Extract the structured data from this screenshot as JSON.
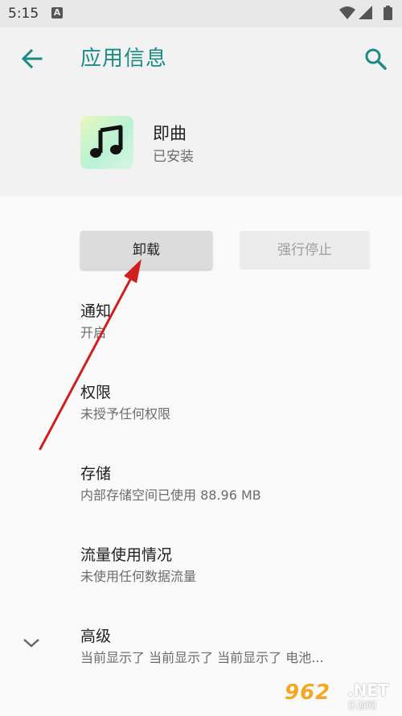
{
  "status_bar": {
    "time": "5:15",
    "notification_icon_letter": "A",
    "icons": [
      "wifi-icon",
      "signal-icon",
      "battery-icon"
    ]
  },
  "header": {
    "title": "应用信息",
    "back_icon": "arrow-left-icon",
    "search_icon": "search-icon"
  },
  "app": {
    "name": "即曲",
    "status": "已安装",
    "icon": "music-note-icon"
  },
  "buttons": {
    "uninstall": "卸载",
    "force_stop": "强行停止"
  },
  "items": [
    {
      "title": "通知",
      "summary": "开启"
    },
    {
      "title": "权限",
      "summary": "未授予任何权限"
    },
    {
      "title": "存储",
      "summary": "内部存储空间已使用 88.96 MB"
    },
    {
      "title": "流量使用情况",
      "summary": "未使用任何数据流量"
    },
    {
      "title": "高级",
      "summary": "当前显示了 当前显示了 当前显示了 电池..."
    }
  ],
  "watermark": {
    "logo": "962",
    "net": ".NET",
    "sub": "乐游网"
  },
  "colors": {
    "accent": "#1a8c84",
    "annotation_arrow": "#d11f1f",
    "header_bg": "#f2f2f2",
    "content_bg": "#fafafa"
  }
}
